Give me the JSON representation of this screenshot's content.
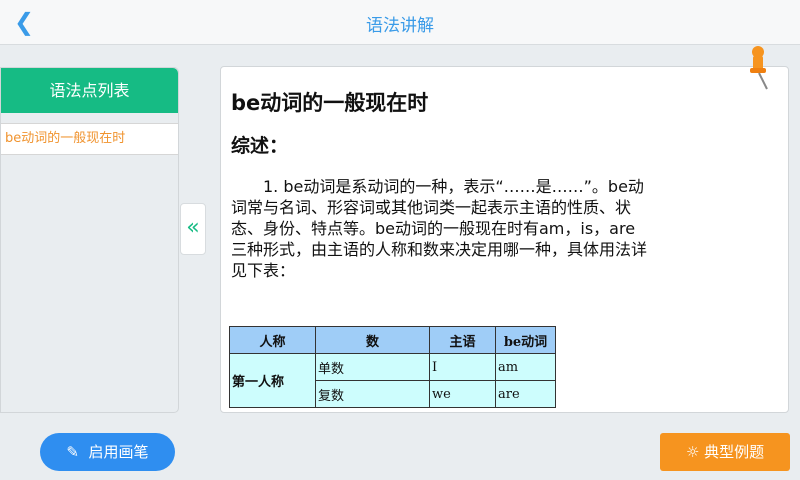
{
  "header": {
    "back_icon": "chevron-left",
    "title": "语法讲解"
  },
  "sidebar": {
    "title": "语法点列表",
    "items": [
      {
        "label": "be动词的一般现在时"
      }
    ],
    "collapse_icon": "«"
  },
  "article": {
    "title": "be动词的一般现在时",
    "section": "综述：",
    "paragraph": "1. be动词是系动词的一种，表示“……是……”。be动词常与名词、形容词或其他词类一起表示主语的性质、状态、身份、特点等。be动词的一般现在时有am，is，are三种形式，由主语的人称和数来决定用哪一种，具体用法详见下表：",
    "table": {
      "headers": [
        "人称",
        "数",
        "主语",
        "be动词"
      ],
      "group": "第一人称",
      "rows": [
        [
          "单数",
          "I",
          "am"
        ],
        [
          "复数",
          "we",
          "are"
        ]
      ]
    }
  },
  "footer": {
    "pen_label": "启用画笔",
    "examples_label": "典型例题"
  }
}
